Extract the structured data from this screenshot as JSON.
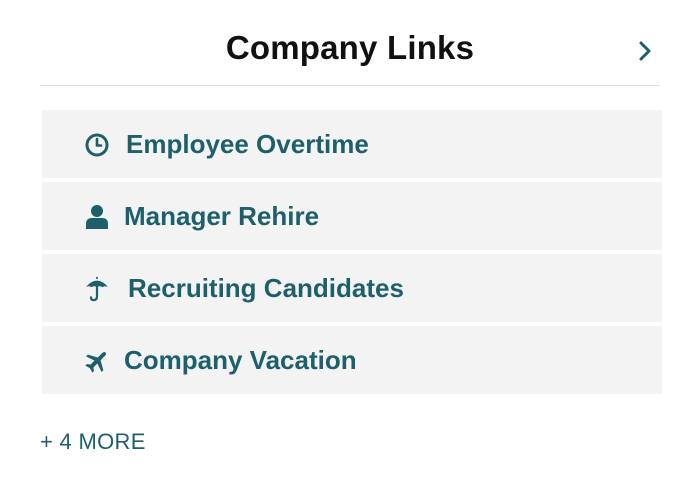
{
  "header": {
    "title": "Company Links",
    "next_icon": "chevron-right-icon"
  },
  "links": [
    {
      "label": "Employee Overtime",
      "icon": "clock-icon"
    },
    {
      "label": "Manager Rehire",
      "icon": "user-icon"
    },
    {
      "label": "Recruiting Candidates",
      "icon": "umbrella-icon"
    },
    {
      "label": "Company Vacation",
      "icon": "airplane-icon"
    }
  ],
  "more_label": "+ 4 MORE",
  "colors": {
    "accent": "#1d5f6b",
    "item_background": "#f3f3f3",
    "title": "#111111"
  }
}
